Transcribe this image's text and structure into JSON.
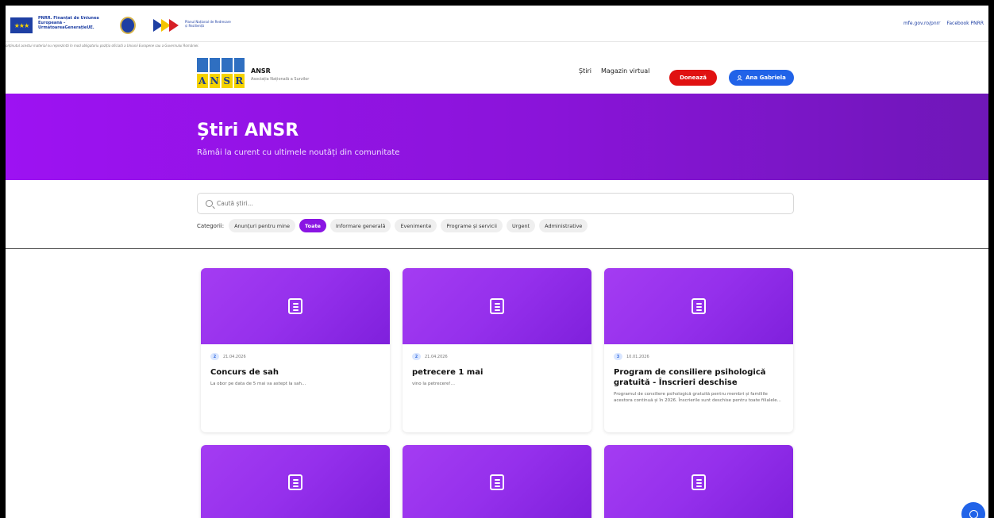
{
  "fundbar": {
    "eu_text": "PNRR. Finanțat de Uniunea Europeană – UrmătoareaGenerațieUE.",
    "pnrr_text": "Planul Național de Redresare și Reziliență",
    "links": [
      "mfe.gov.ro/pnrr",
      "Facebook PNRR"
    ],
    "disclaimer": "onținutul acestui material nu reprezintă în mod obligatoriu poziția oficială a Uniunii Europene sau a Guvernului României."
  },
  "header": {
    "brand_name": "ANSR",
    "brand_sub": "Asociația Națională a Surzilor",
    "logo_letters": [
      "A",
      "N",
      "S",
      "R"
    ],
    "nav": [
      "Știri",
      "Magazin virtual"
    ],
    "donate_label": "Donează",
    "user_label": "Ana Gabriela",
    "user_icon": "person-icon"
  },
  "hero": {
    "title": "Știri ANSR",
    "subtitle": "Rămâi la curent cu ultimele noutăți din comunitate",
    "gradient": [
      "#9d12f2",
      "#6f17b8"
    ]
  },
  "filters": {
    "search_placeholder": "Caută știri...",
    "categories_label": "Categorii:",
    "categories": [
      "Anunțuri pentru mine",
      "Toate",
      "Informare generală",
      "Evenimente",
      "Programe și servicii",
      "Urgent",
      "Administrative"
    ],
    "active_category": "Toate"
  },
  "cards": [
    {
      "badge": "2",
      "date": "21.04.2026",
      "title": "Concurs de sah",
      "excerpt": "La obor pe data de 5 mai va astept la sah..."
    },
    {
      "badge": "2",
      "date": "21.04.2026",
      "title": "petrecere 1 mai",
      "excerpt": "vino la petrecere!..."
    },
    {
      "badge": "3",
      "date": "10.01.2026",
      "title": "Program de consiliere psihologică gratuită - Înscrieri deschise",
      "excerpt": "Programul de consiliere psihologică gratuită pentru membri și familiile acestora continuă și în 2026. Înscrierile sunt deschise pentru toate filialele..."
    }
  ],
  "colors": {
    "accent": "#8a15e3",
    "donate": "#e01111",
    "user_button": "#2163e8"
  }
}
